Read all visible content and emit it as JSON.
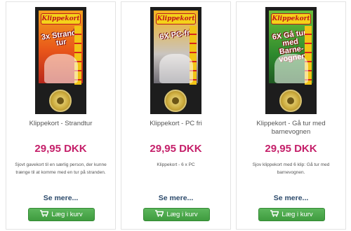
{
  "products": [
    {
      "image": {
        "brand_text": "Klippekort",
        "promo_text": "3x Strand-tur",
        "theme_color": "#e8551a"
      },
      "title": "Klippekort - Strandtur",
      "price": "29,95 DKK",
      "description": "Sjovt gavekort til en særlig person, der kunne trænge til at komme med en tur på stranden.",
      "more_label": "Se mere...",
      "cart_label": "Læg i kurv"
    },
    {
      "image": {
        "brand_text": "Klippekort",
        "promo_text": "6X PC-fri",
        "theme_color": "#c9c4c0"
      },
      "title": "Klippekort - PC fri",
      "price": "29,95 DKK",
      "description": "Klippekort - 6 x PC",
      "more_label": "Se mere...",
      "cart_label": "Læg i kurv"
    },
    {
      "image": {
        "brand_text": "Klippekort",
        "promo_text": "6X Gå tur med Barne-vognen",
        "theme_color": "#2e8a2e"
      },
      "title": "Klippekort - Gå tur med barnevognen",
      "price": "29,95 DKK",
      "description": "Sjov klippekort med 6 klip: Gå tur med barnevognen.",
      "more_label": "Se mere...",
      "cart_label": "Læg i kurv"
    }
  ],
  "colors": {
    "price": "#c5206a",
    "button": "#4aa84a",
    "link": "#2c4a6b"
  }
}
